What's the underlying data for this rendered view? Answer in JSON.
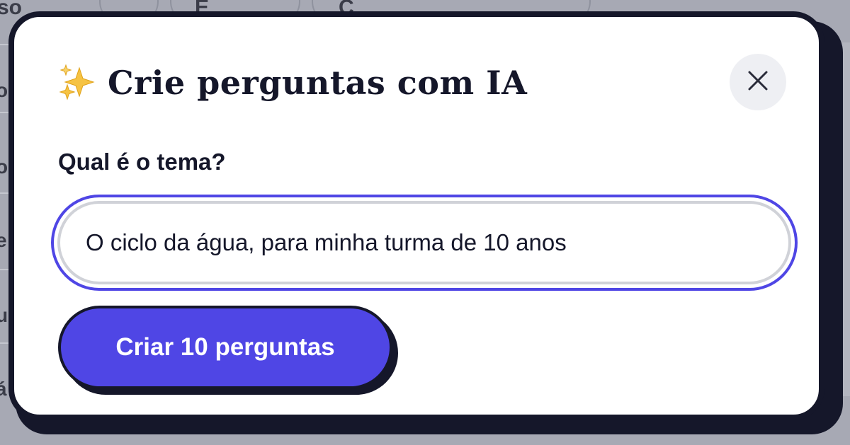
{
  "background": {
    "top_tabs": [
      "so",
      "E",
      "C"
    ],
    "left_fragments": [
      "o",
      "o",
      "e",
      "u",
      "á"
    ]
  },
  "modal": {
    "title": "Crie perguntas com IA",
    "title_icon": "sparkles-icon",
    "close_icon": "close-icon",
    "field_label": "Qual é o tema?",
    "input_value": "O ciclo da água, para minha turma de 10 anos",
    "submit_label": "Criar 10 perguntas"
  },
  "colors": {
    "accent": "#4f46e5",
    "ink": "#15172a",
    "backdrop": "#a7a9b4",
    "sparkle": "#f6c343"
  }
}
